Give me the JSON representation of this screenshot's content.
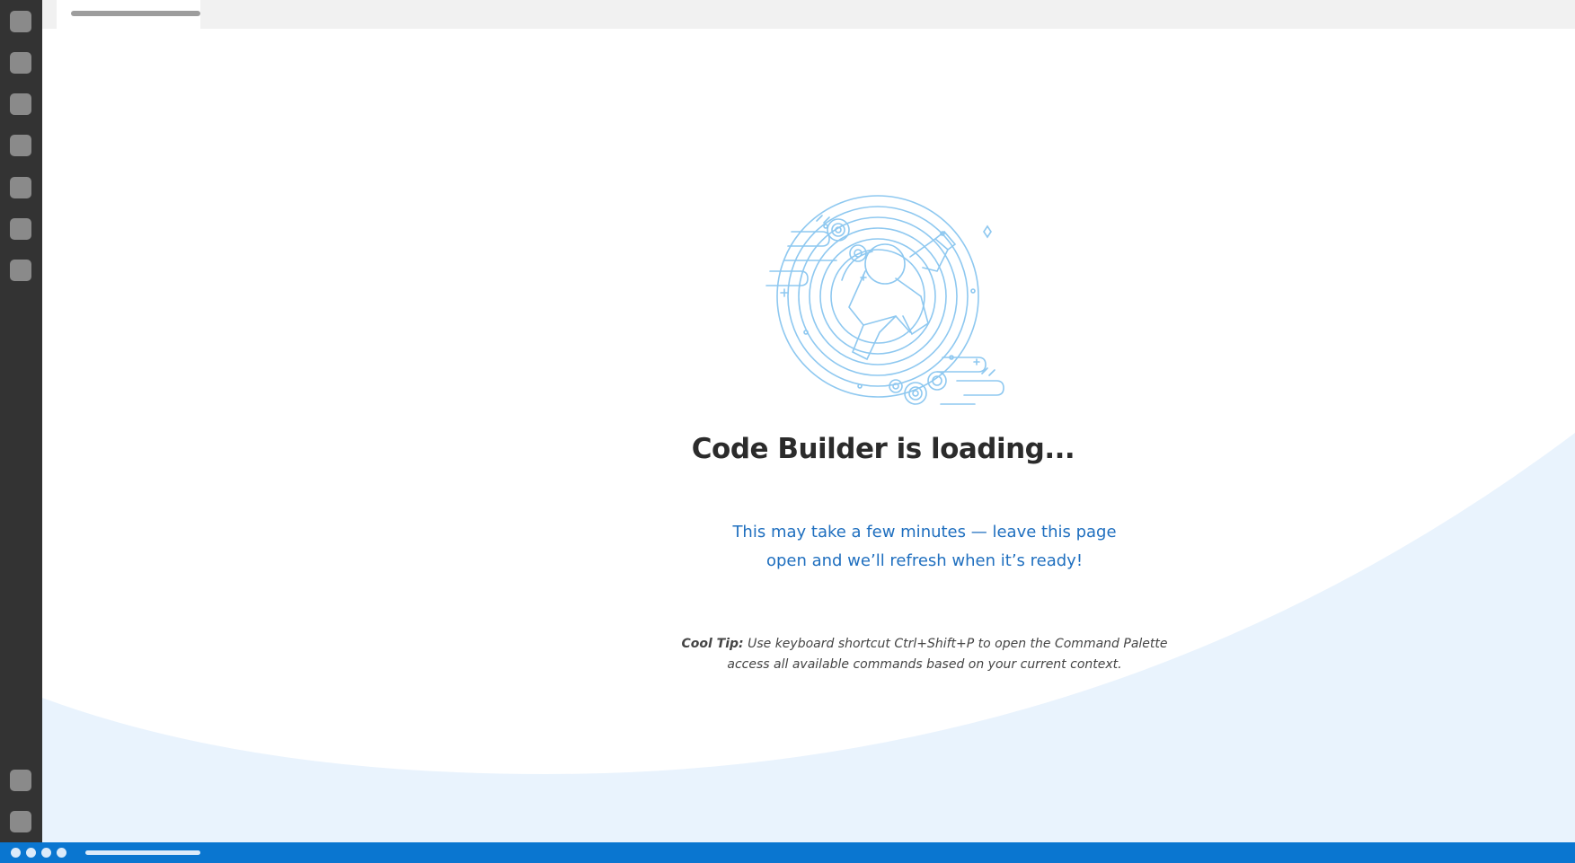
{
  "loading": {
    "title": "Code Builder is loading...",
    "subtitle_line1": "This may take a few minutes — leave this page",
    "subtitle_line2": "open and we’ll refresh when it’s ready!",
    "tip_label": "Cool Tip:",
    "tip_text": "Use keyboard shortcut Ctrl+Shift+P to open the Command Palette access all available commands based on your current context."
  },
  "icons": {
    "illustration": "astronaut-portal-illustration",
    "activity_bar": [
      "explorer-icon",
      "search-icon",
      "source-control-icon",
      "run-debug-icon",
      "extensions-icon",
      "testing-icon",
      "remote-icon",
      "account-icon",
      "settings-icon"
    ]
  },
  "colors": {
    "activity_bar": "#333333",
    "status_bar": "#0a76d0",
    "accent_text": "#1f6fbf",
    "illustration_stroke": "#8ec8f0",
    "wave_fill": "#e9f3fd"
  }
}
